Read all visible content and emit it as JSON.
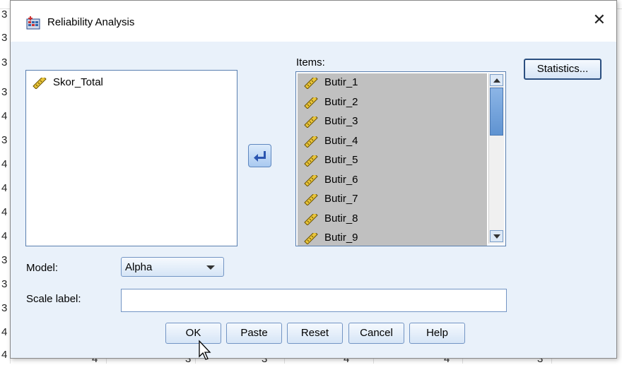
{
  "background": {
    "gutter_numbers": [
      "3",
      "3",
      "3",
      "3",
      "4",
      "3",
      "4",
      "4",
      "4",
      "4",
      "3",
      "3",
      "3",
      "4",
      "4"
    ],
    "bottom_numbers": [
      "4",
      "3",
      "3",
      "4",
      "4",
      "3"
    ]
  },
  "dialog": {
    "title": "Reliability Analysis",
    "close_icon": "close-icon",
    "title_icon": "spss-reliability-icon"
  },
  "source_list": {
    "items": [
      {
        "label": "Skor_Total",
        "icon": "scale-ruler-icon"
      }
    ]
  },
  "items_list": {
    "label": "Items:",
    "items": [
      {
        "label": "Butir_1"
      },
      {
        "label": "Butir_2"
      },
      {
        "label": "Butir_3"
      },
      {
        "label": "Butir_4"
      },
      {
        "label": "Butir_5"
      },
      {
        "label": "Butir_6"
      },
      {
        "label": "Butir_7"
      },
      {
        "label": "Butir_8"
      },
      {
        "label": "Butir_9"
      }
    ]
  },
  "buttons": {
    "statistics": "Statistics...",
    "ok": "OK",
    "paste": "Paste",
    "reset": "Reset",
    "cancel": "Cancel",
    "help": "Help",
    "move_icon": "arrow-left-icon"
  },
  "model": {
    "label": "Model:",
    "selected": "Alpha"
  },
  "scale_label": {
    "label": "Scale label:",
    "value": ""
  },
  "colors": {
    "dialog_bg": "#e9f1fa",
    "selection_bg": "#c0c0c0",
    "button_border": "#7395c4"
  }
}
